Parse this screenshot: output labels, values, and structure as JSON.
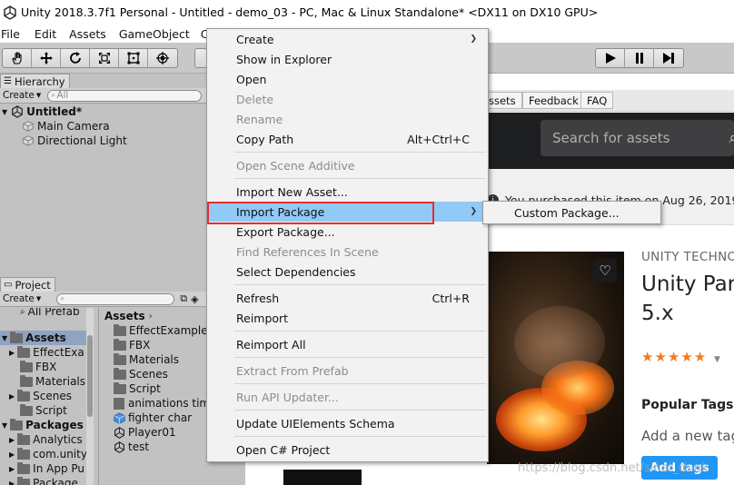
{
  "window": {
    "title": "Unity 2018.3.7f1 Personal - Untitled - demo_03 - PC, Mac & Linux Standalone* <DX11 on DX10 GPU>"
  },
  "menubar": {
    "items": [
      "File",
      "Edit",
      "Assets",
      "GameObject",
      "Cor"
    ]
  },
  "toolbar": {
    "tools": [
      "hand-tool",
      "move-tool",
      "rotate-tool",
      "scale-tool",
      "rect-tool",
      "transform-tool"
    ],
    "playback": [
      "play",
      "pause",
      "step"
    ]
  },
  "hierarchy": {
    "tab_label": "Hierarchy",
    "create_label": "Create",
    "search_placeholder": "All",
    "scene_name": "Untitled*",
    "items": [
      "Main Camera",
      "Directional Light"
    ]
  },
  "project": {
    "tab_label": "Project",
    "create_label": "Create",
    "left_tree": [
      {
        "label": "All Prefab",
        "depth": 1
      },
      {
        "label": "Assets",
        "depth": 0,
        "bold": true,
        "selected": true
      },
      {
        "label": "EffectExa",
        "depth": 1
      },
      {
        "label": "FBX",
        "depth": 1
      },
      {
        "label": "Materials",
        "depth": 1
      },
      {
        "label": "Scenes",
        "depth": 1
      },
      {
        "label": "Script",
        "depth": 1
      },
      {
        "label": "Packages",
        "depth": 0,
        "bold": true
      },
      {
        "label": "Analytics",
        "depth": 1
      },
      {
        "label": "com.unity",
        "depth": 1
      },
      {
        "label": "In App Pu",
        "depth": 1
      },
      {
        "label": "Package",
        "depth": 1
      }
    ],
    "breadcrumb": "Assets",
    "right_items": [
      {
        "label": "EffectExamples",
        "icon": "folder"
      },
      {
        "label": "FBX",
        "icon": "folder"
      },
      {
        "label": "Materials",
        "icon": "folder"
      },
      {
        "label": "Scenes",
        "icon": "folder"
      },
      {
        "label": "Script",
        "icon": "folder"
      },
      {
        "label": "animations tim",
        "icon": "file"
      },
      {
        "label": "fighter char",
        "icon": "prefab"
      },
      {
        "label": "Player01",
        "icon": "unity"
      },
      {
        "label": "test",
        "icon": "unity"
      }
    ]
  },
  "store": {
    "tabs": [
      "ssets",
      "Feedback",
      "FAQ"
    ],
    "search_placeholder": "Search for assets",
    "notice": "You purchased this item on Aug 26, 2019",
    "publisher": "UNITY TECHNOL",
    "title_line1": "Unity Part",
    "title_line2": "5.x",
    "stars": "★★★★★",
    "popular_tags_heading": "Popular Tags",
    "tag_input_placeholder": "Add a new tag",
    "add_tags_button": "Add tags"
  },
  "context_menu": {
    "items": [
      {
        "label": "Create",
        "submenu": true,
        "enabled": true
      },
      {
        "label": "Show in Explorer",
        "enabled": true
      },
      {
        "label": "Open",
        "enabled": true
      },
      {
        "label": "Delete",
        "enabled": false
      },
      {
        "label": "Rename",
        "enabled": false
      },
      {
        "label": "Copy Path",
        "shortcut": "Alt+Ctrl+C",
        "enabled": true
      },
      {
        "label": "Open Scene Additive",
        "enabled": false
      },
      {
        "label": "Import New Asset...",
        "enabled": true
      },
      {
        "label": "Import Package",
        "submenu": true,
        "enabled": true,
        "highlighted": true
      },
      {
        "label": "Export Package...",
        "enabled": true
      },
      {
        "label": "Find References In Scene",
        "enabled": false
      },
      {
        "label": "Select Dependencies",
        "enabled": true
      },
      {
        "label": "Refresh",
        "shortcut": "Ctrl+R",
        "enabled": true
      },
      {
        "label": "Reimport",
        "enabled": true
      },
      {
        "label": "Reimport All",
        "enabled": true
      },
      {
        "label": "Extract From Prefab",
        "enabled": false
      },
      {
        "label": "Run API Updater...",
        "enabled": false
      },
      {
        "label": "Update UIElements Schema",
        "enabled": true
      },
      {
        "label": "Open C# Project",
        "enabled": true
      }
    ]
  },
  "submenu": {
    "items": [
      "Custom Package..."
    ]
  },
  "watermark": "https://blog.csdn.net/sinat_dunk",
  "colors": {
    "highlight": "#91c9f7",
    "highlight_border": "#e03030",
    "store_header": "#1d1e20",
    "add_tags_button": "#2196f3",
    "stars": "#f47b20"
  }
}
